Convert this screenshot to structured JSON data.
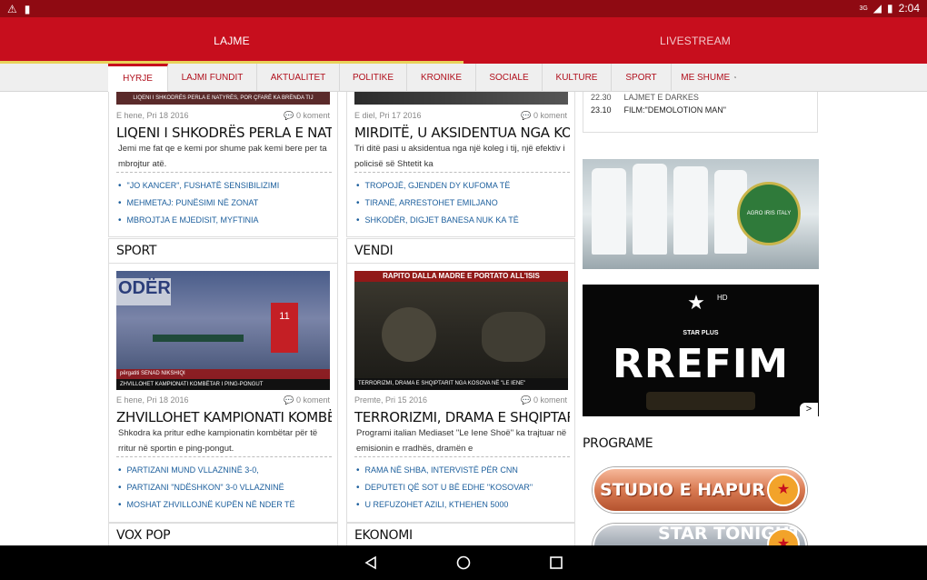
{
  "status": {
    "time": "2:04",
    "signal": "3G"
  },
  "appbar": {
    "tabs": [
      {
        "label": "LAJME"
      },
      {
        "label": "LIVESTREAM"
      }
    ]
  },
  "nav": {
    "items": [
      "HYRJE",
      "LAJMI FUNDIT",
      "AKTUALITET",
      "POLITIKE",
      "KRONIKE",
      "SOCIALE",
      "KULTURE",
      "SPORT",
      "ME SHUME"
    ]
  },
  "col1": {
    "top_img_caption": "LIQENI I SHKODRËS PERLA E NATYRËS, POR ÇFARË KA BRËNDA TIJ",
    "top_date": "E hene, Pri 18 2016",
    "top_comments": "0 koment",
    "top_headline": "LIQENI I SHKODRËS PERLA E NATYRËS,",
    "top_excerpt_1": "Jemi me fat qe e kemi por shume pak kemi bere per ta",
    "top_excerpt_2": "mbrojtur atë.",
    "top_bullets": [
      "\"JO KANCER\", FUSHATË SENSIBILIZIMI",
      "MEHMETAJ: PUNËSIMI NË ZONAT",
      "MBROJTJA E MJEDISIT, MYFTINIA"
    ],
    "section": "SPORT",
    "sport_img_caption_1": "përgatiti SENAD NIKSHIQI",
    "sport_img_caption_2": "ZHVILLOHET KAMPIONATI KOMBËTAR I PING-PONGUT",
    "sport_date": "E hene, Pri 18 2016",
    "sport_comments": "0 koment",
    "sport_headline": "ZHVILLOHET KAMPIONATI KOMBËTAR I",
    "sport_excerpt_1": "Shkodra ka pritur edhe kampionatin kombëtar për të",
    "sport_excerpt_2": "rritur në sportin e ping-pongut.",
    "sport_bullets": [
      "PARTIZANI MUND VLLAZNINË 3-0,",
      "PARTIZANI \"NDËSHKON\" 3-0 VLLAZNINË",
      "MOSHAT ZHVILLOJNË KUPËN NË NDER TË"
    ],
    "bottom_section": "VOX POP"
  },
  "col2": {
    "top_date": "E diel, Pri 17 2016",
    "top_comments": "0 koment",
    "top_headline": "MIRDITË, U AKSIDENTUA NGA KOLEGU I",
    "top_excerpt_1": "Tri ditë pasi u aksidentua nga një koleg i tij, një efektiv i",
    "top_excerpt_2": "policisë së Shtetit ka",
    "top_bullets": [
      "TROPOJË, GJENDEN DY KUFOMA TË",
      "TIRANË, ARRESTOHET EMILJANO",
      "SHKODËR, DIGJET BANESA NUK KA TË"
    ],
    "section": "VENDI",
    "vendi_img_caption_top": "RAPITO DALLA MADRE E PORTATO ALL'ISIS",
    "vendi_img_caption_bottom": "TERRORIZMI, DRAMA E SHQIPTARIT NGA KOSOVA NË \"LE IENE\"",
    "vendi_date": "Premte, Pri 15 2016",
    "vendi_comments": "0 koment",
    "vendi_headline": "TERRORIZMI, DRAMA E SHQIPTARIT NGA",
    "vendi_excerpt_1": "Programi italian Mediaset \"Le Iene Shoё\" ka trajtuar në",
    "vendi_excerpt_2": "emisionin e rradhës, dramën e",
    "vendi_bullets": [
      "RAMA NË SHBA, INTERVISTË PËR CNN",
      "DEPUTETI QË SOT U BË EDHE \"KOSOVAR\"",
      "U REFUZOHET AZILI, KTHEHEN 5000"
    ],
    "bottom_section": "EKONOMI"
  },
  "col3": {
    "schedule": [
      {
        "time": "22.30",
        "title": "LAJMET E DARKES"
      },
      {
        "time": "23.10",
        "title": "FILM:\"DEMOLOTION MAN\""
      }
    ],
    "ad1_text": "AGRO IRIS ITALY",
    "ad2_logo": "STAR PLUS",
    "ad2_hd": "HD",
    "ad2_title": "RREFIM",
    "section": "PROGRAME",
    "prog1": "STUDIO E HAPUR",
    "prog2": "STAR TONIGHT"
  },
  "colors": {
    "brand_red": "#c70e1d",
    "status_red": "#8f0a12",
    "link_blue": "#1b5e9c"
  }
}
